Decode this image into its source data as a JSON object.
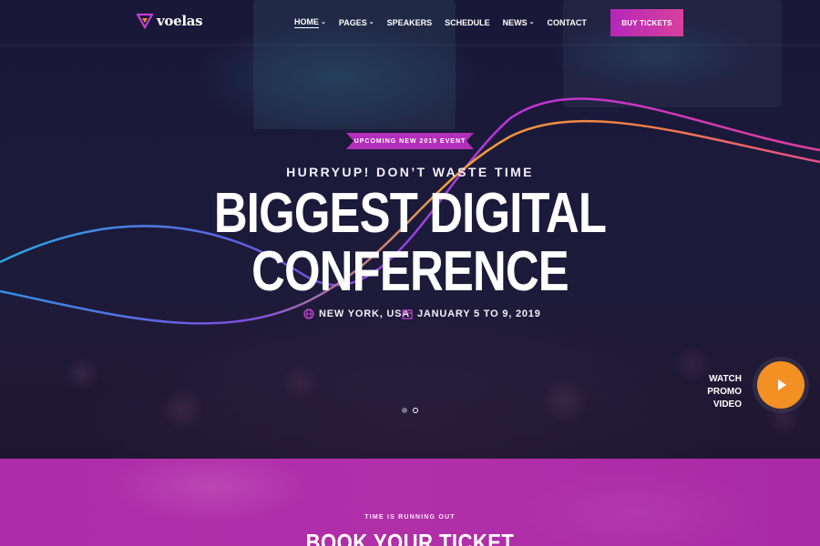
{
  "brand": {
    "name": "voelas",
    "colors": {
      "primary": "#b427b9",
      "accent": "#f39024",
      "background": "#1a1838"
    }
  },
  "nav": {
    "items": [
      {
        "label": "HOME",
        "has_dropdown": true,
        "active": true
      },
      {
        "label": "PAGES",
        "has_dropdown": true,
        "active": false
      },
      {
        "label": "SPEAKERS",
        "has_dropdown": false,
        "active": false
      },
      {
        "label": "SCHEDULE",
        "has_dropdown": false,
        "active": false
      },
      {
        "label": "NEWS",
        "has_dropdown": true,
        "active": false
      },
      {
        "label": "CONTACT",
        "has_dropdown": false,
        "active": false
      }
    ],
    "cta_label": "BUY TICKETS"
  },
  "hero": {
    "ribbon": "UPCOMING NEW 2019 EVENT",
    "subheading": "HURRYUP! DON’T WASTE TIME",
    "title_line1": "BIGGEST DIGITAL",
    "title_line2": "CONFERENCE",
    "location": "NEW YORK, USA",
    "date": "JANUARY 5 TO 9, 2019",
    "location_icon": "globe-icon",
    "date_icon": "calendar-icon",
    "slider": {
      "count": 2,
      "active": 2
    },
    "promo_line1": "WATCH PROMO",
    "promo_line2": "VIDEO"
  },
  "tickets": {
    "kicker": "TIME IS RUNNING OUT",
    "title": "BOOK YOUR TICKET"
  }
}
